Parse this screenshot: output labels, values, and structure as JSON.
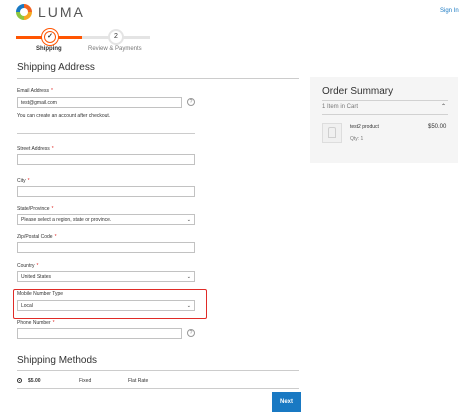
{
  "header": {
    "logo_text": "LUMA",
    "sign_in": "Sign In"
  },
  "progress": {
    "step1_label": "Shipping",
    "step2_number": "2",
    "step2_label": "Review & Payments",
    "step1_icon": "checkmark-icon"
  },
  "shipping_address": {
    "title": "Shipping Address",
    "email_label": "Email Address",
    "email_value": "test@gmail.com",
    "help_glyph": "?",
    "email_note": "You can create an account after checkout.",
    "street_label": "Street Address",
    "city_label": "City",
    "state_label": "State/Province",
    "state_value": "Please select a region, state or province.",
    "zip_label": "Zip/Postal Code",
    "country_label": "Country",
    "country_value": "United States",
    "mobile_type_label": "Mobile Number Type",
    "mobile_type_value": "Local",
    "phone_label": "Phone Number",
    "required_mark": "*"
  },
  "shipping_methods": {
    "title": "Shipping Methods",
    "price": "$5.00",
    "carrier_title": "Fixed",
    "method_title": "Flat Rate",
    "next_button": "Next"
  },
  "order_summary": {
    "title": "Order Summary",
    "items_in_cart": "1 Item in Cart",
    "product_name": "test2 product",
    "product_price": "$50.00",
    "product_qty": "Qty: 1"
  },
  "colors": {
    "accent": "#ff5501",
    "link": "#1979c3",
    "highlight_border": "#e02b27"
  }
}
